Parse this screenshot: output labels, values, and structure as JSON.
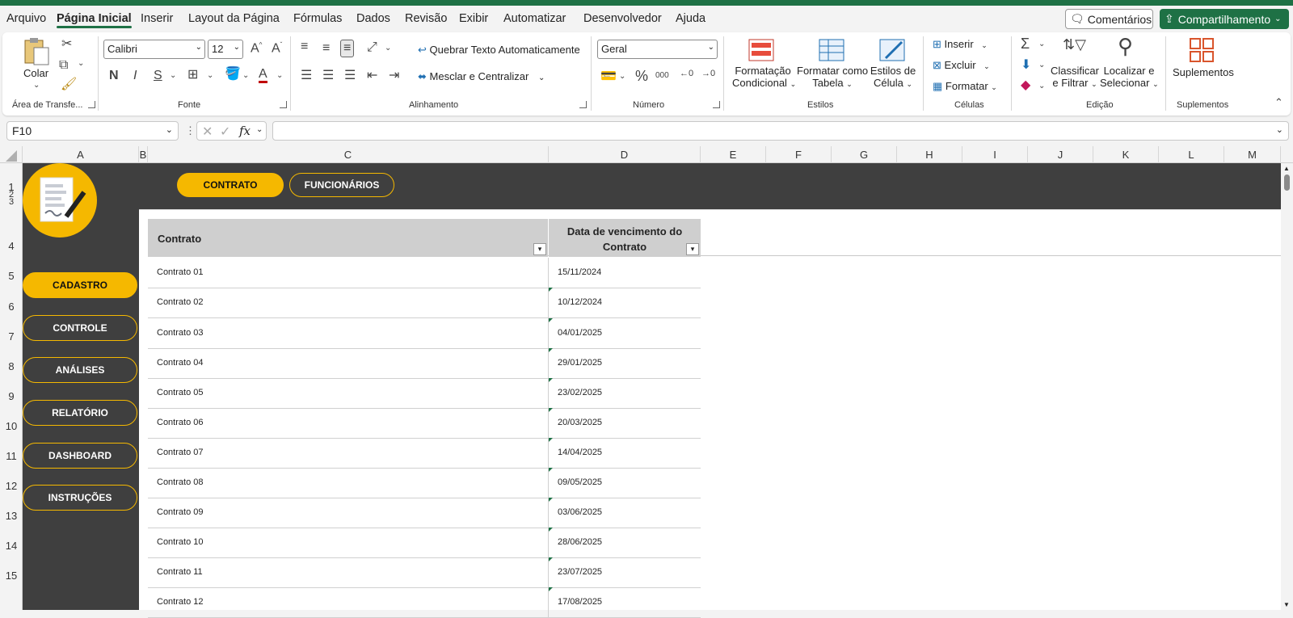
{
  "menu": [
    "Arquivo",
    "Página Inicial",
    "Inserir",
    "Layout da Página",
    "Fórmulas",
    "Dados",
    "Revisão",
    "Exibir",
    "Automatizar",
    "Desenvolvedor",
    "Ajuda"
  ],
  "comments_label": "Comentários",
  "share_label": "Compartilhamento",
  "ribbon": {
    "clipboard": {
      "paste_label": "Colar",
      "group": "Área de Transfe..."
    },
    "font": {
      "name": "Calibri",
      "size": "12",
      "bold": "N",
      "italic": "I",
      "underline": "S",
      "group": "Fonte"
    },
    "alignment": {
      "wrap_label": "Quebrar Texto Automaticamente",
      "merge_label": "Mesclar e Centralizar",
      "group": "Alinhamento"
    },
    "number": {
      "format": "Geral",
      "group": "Número"
    },
    "styles": {
      "cond_1": "Formatação",
      "cond_2": "Condicional",
      "table_1": "Formatar como",
      "table_2": "Tabela",
      "cell_1": "Estilos de",
      "cell_2": "Célula",
      "group": "Estilos"
    },
    "cells": {
      "insert": "Inserir",
      "delete": "Excluir",
      "format": "Formatar",
      "group": "Células"
    },
    "editing": {
      "sort_1": "Classificar",
      "sort_2": "e Filtrar",
      "find_1": "Localizar e",
      "find_2": "Selecionar",
      "group": "Edição"
    },
    "addins": {
      "label": "Suplementos",
      "group": "Suplementos"
    }
  },
  "formula_bar": {
    "name_box": "F10",
    "formula": ""
  },
  "columns": [
    "A",
    "B",
    "C",
    "D",
    "E",
    "F",
    "G",
    "H",
    "I",
    "J",
    "K",
    "L",
    "M"
  ],
  "rows": [
    "1",
    "2",
    "3",
    "4",
    "5",
    "6",
    "7",
    "8",
    "9",
    "10",
    "11",
    "12",
    "13",
    "14",
    "15"
  ],
  "top_nav": [
    "CONTRATO",
    "FUNCIONÁRIOS"
  ],
  "side_nav": [
    "CADASTRO",
    "CONTROLE",
    "ANÁLISES",
    "RELATÓRIO",
    "DASHBOARD",
    "INSTRUÇÕES"
  ],
  "table": {
    "headers": [
      "Contrato",
      "Data de vencimento do Contrato"
    ],
    "rows": [
      [
        "Contrato 01",
        "15/11/2024"
      ],
      [
        "Contrato 02",
        "10/12/2024"
      ],
      [
        "Contrato 03",
        "04/01/2025"
      ],
      [
        "Contrato 04",
        "29/01/2025"
      ],
      [
        "Contrato 05",
        "23/02/2025"
      ],
      [
        "Contrato 06",
        "20/03/2025"
      ],
      [
        "Contrato 07",
        "14/04/2025"
      ],
      [
        "Contrato 08",
        "09/05/2025"
      ],
      [
        "Contrato 09",
        "03/06/2025"
      ],
      [
        "Contrato 10",
        "28/06/2025"
      ],
      [
        "Contrato 11",
        "23/07/2025"
      ],
      [
        "Contrato 12",
        "17/08/2025"
      ]
    ]
  },
  "colors": {
    "excel_green": "#1e7145",
    "accent_yellow": "#f5b800",
    "panel_dark": "#3f3f3f",
    "header_gray": "#cfcfcf"
  }
}
